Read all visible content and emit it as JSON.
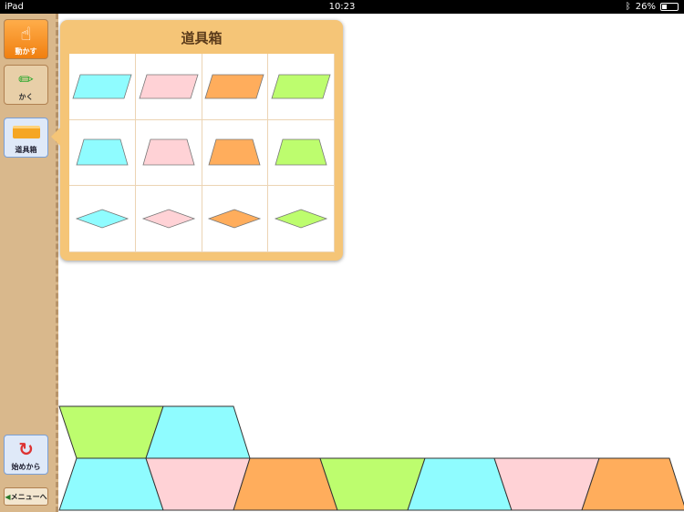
{
  "status": {
    "device": "iPad",
    "time": "10:23",
    "battery": "26%"
  },
  "sidebar": {
    "move": "動かす",
    "draw": "かく",
    "toolbox": "道具箱",
    "restart": "始めから",
    "menu": "メニューへ"
  },
  "popup": {
    "title": "道具箱"
  },
  "colors": {
    "cyan": "#8ffcff",
    "pink": "#ffd2d6",
    "orange": "#ffad5c",
    "green": "#bdfd6e"
  },
  "tools": [
    {
      "shape": "parallelogram",
      "colors": [
        "cyan",
        "pink",
        "orange",
        "green"
      ]
    },
    {
      "shape": "trapezoid",
      "colors": [
        "cyan",
        "pink",
        "orange",
        "green"
      ]
    },
    {
      "shape": "rhombus",
      "colors": [
        "cyan",
        "pink",
        "orange",
        "green"
      ]
    }
  ],
  "placed": [
    {
      "shape": "trapezoid",
      "color": "green"
    },
    {
      "shape": "trapezoid",
      "color": "cyan"
    },
    {
      "shape": "trapezoid",
      "color": "cyan"
    },
    {
      "shape": "trapezoid",
      "color": "pink"
    },
    {
      "shape": "trapezoid",
      "color": "orange"
    },
    {
      "shape": "trapezoid",
      "color": "green"
    },
    {
      "shape": "trapezoid",
      "color": "cyan"
    },
    {
      "shape": "trapezoid",
      "color": "pink"
    },
    {
      "shape": "trapezoid",
      "color": "orange"
    }
  ]
}
